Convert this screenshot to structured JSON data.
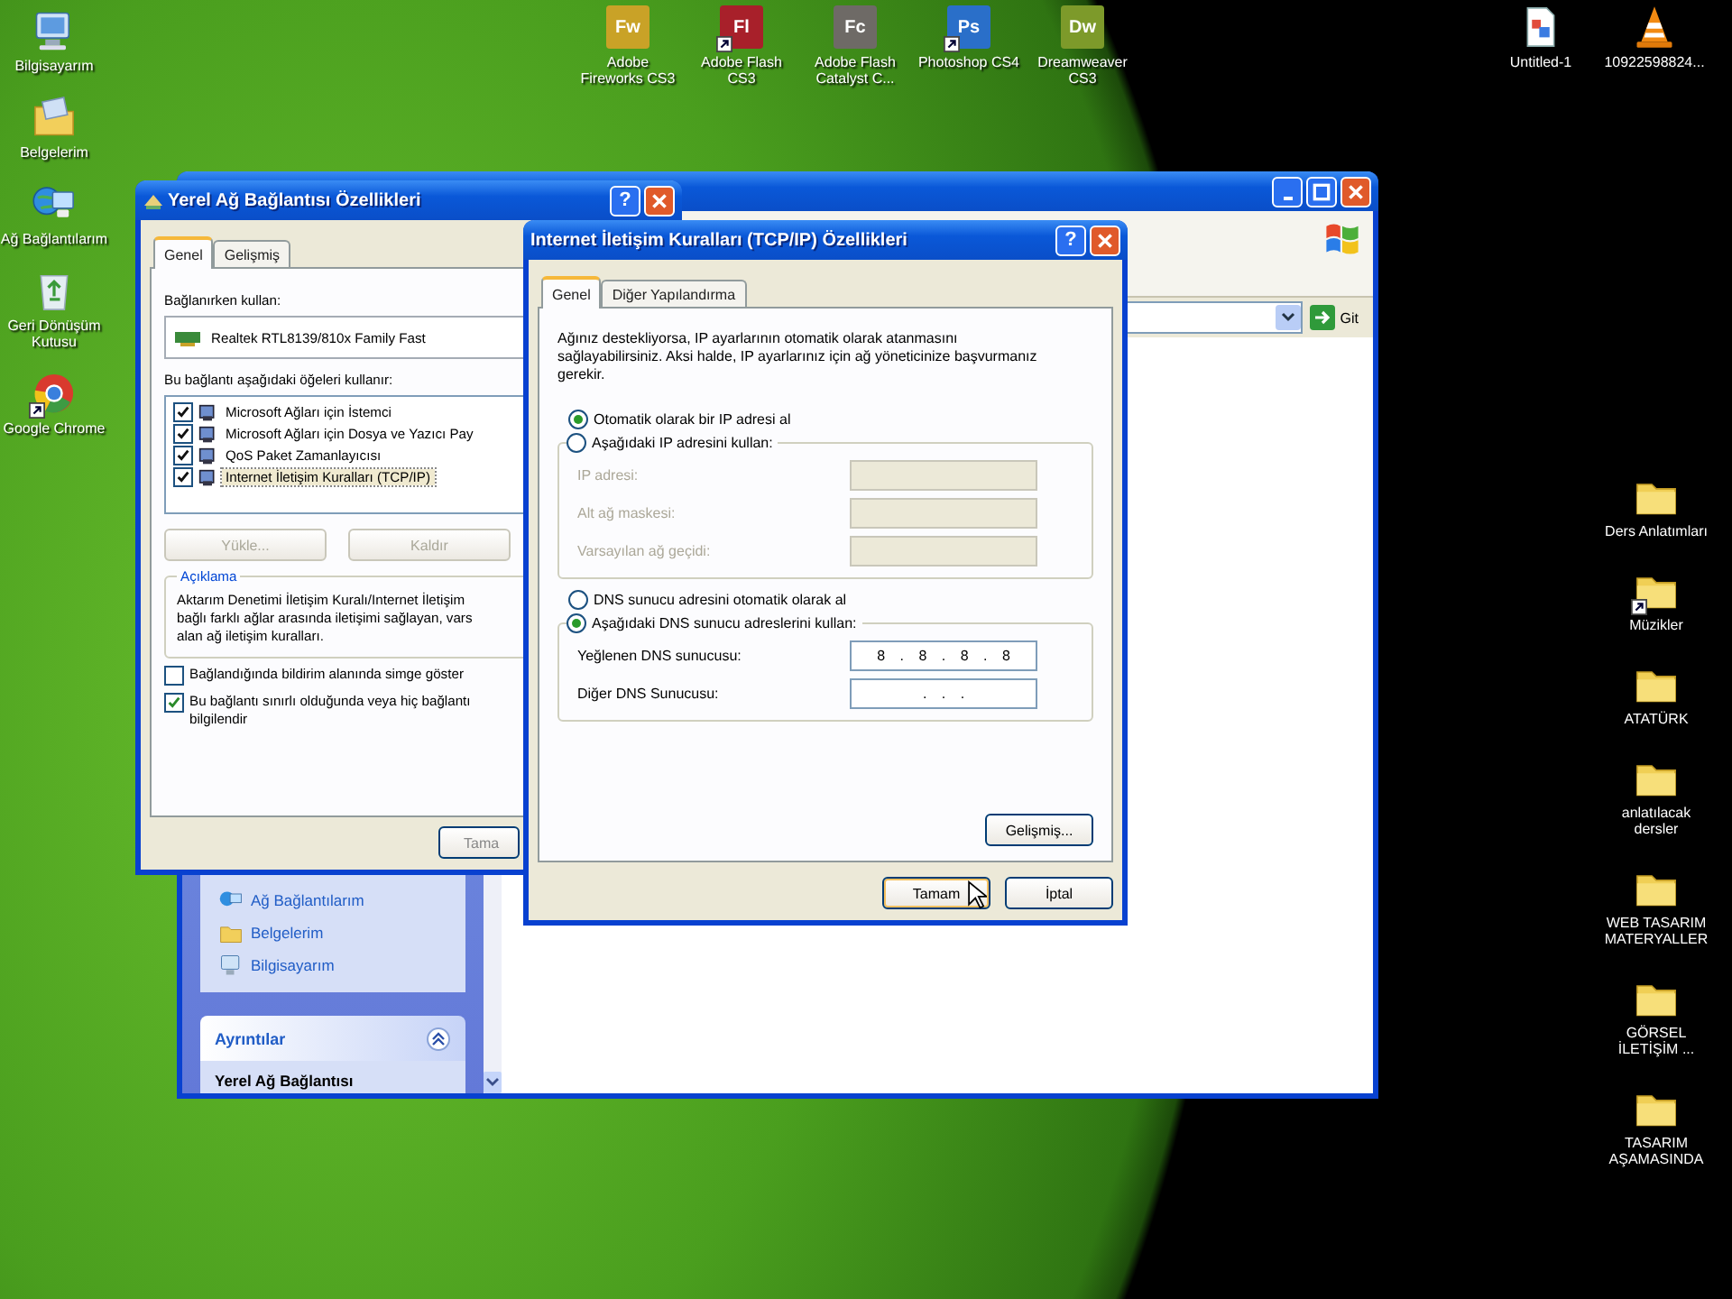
{
  "desktop": {
    "left_icons": [
      {
        "kind": "computer",
        "label": "Bilgisayarım",
        "shortcut": false
      },
      {
        "kind": "documents",
        "label": "Belgelerim",
        "shortcut": false
      },
      {
        "kind": "network",
        "label": "Ağ Bağlantılarım",
        "shortcut": false
      },
      {
        "kind": "recycle",
        "label": "Geri Dönüşüm Kutusu",
        "shortcut": false
      },
      {
        "kind": "browser",
        "label": "Google Chrome",
        "shortcut": true
      }
    ],
    "top_icons": [
      {
        "kind": "app",
        "badge": "Fw",
        "color": "#c9a227",
        "label": "Adobe Fireworks CS3",
        "shortcut": false
      },
      {
        "kind": "app",
        "badge": "Fl",
        "color": "#a8202a",
        "label": "Adobe Flash CS3",
        "shortcut": true
      },
      {
        "kind": "app",
        "badge": "Fc",
        "color": "#6e6a66",
        "label": "Adobe Flash Catalyst C...",
        "shortcut": false
      },
      {
        "kind": "app",
        "badge": "Ps",
        "color": "#2a6fc9",
        "label": "Photoshop CS4",
        "shortcut": true
      },
      {
        "kind": "app",
        "badge": "Dw",
        "color": "#7d9a2a",
        "label": "Dreamweaver CS3",
        "shortcut": false
      }
    ],
    "top_right_icons": [
      {
        "kind": "file",
        "label": "Untitled-1",
        "shortcut": false
      },
      {
        "kind": "cone",
        "label": "10922598824...",
        "shortcut": false
      }
    ],
    "right_icons": [
      {
        "kind": "folder",
        "label": "Ders Anlatımları",
        "shortcut": false
      },
      {
        "kind": "folder",
        "label": "Müzikler",
        "shortcut": true
      },
      {
        "kind": "folder",
        "label": "ATATÜRK",
        "shortcut": false
      },
      {
        "kind": "folder",
        "label": "anlatılacak dersler",
        "shortcut": false
      },
      {
        "kind": "folder",
        "label": "WEB TASARIM MATERYALLER",
        "shortcut": false
      },
      {
        "kind": "folder",
        "label": "GÖRSEL İLETİŞİM ...",
        "shortcut": false
      },
      {
        "kind": "folder",
        "label": "TASARIM AŞAMASINDA",
        "shortcut": false
      }
    ]
  },
  "explorer_window": {
    "go_button": "Git",
    "tasks": [
      {
        "kind": "network",
        "label": "Ağ Bağlantılarım"
      },
      {
        "kind": "documents",
        "label": "Belgelerim"
      },
      {
        "kind": "computer",
        "label": "Bilgisayarım"
      }
    ],
    "details": {
      "title": "Ayrıntılar",
      "expanded": true,
      "name": "Yerel Ağ Bağlantısı"
    }
  },
  "connection_dialog": {
    "title": "Yerel Ağ Bağlantısı Özellikleri",
    "help_button": "?",
    "tabs": [
      {
        "label": "Genel",
        "selected": true
      },
      {
        "label": "Gelişmiş",
        "selected": false
      }
    ],
    "connect_label": "Bağlanırken kullan:",
    "adapter": "Realtek RTL8139/810x Family Fast",
    "components_label": "Bu bağlantı aşağıdaki öğeleri kullanır:",
    "components": [
      {
        "label": "Microsoft Ağları için İstemci",
        "checked": true,
        "selected": false
      },
      {
        "label": "Microsoft Ağları için Dosya ve Yazıcı Pay",
        "checked": true,
        "selected": false
      },
      {
        "label": "QoS Paket Zamanlayıcısı",
        "checked": true,
        "selected": false
      },
      {
        "label": "Internet İletişim Kuralları (TCP/IP)",
        "checked": true,
        "selected": true
      }
    ],
    "buttons": [
      {
        "label": "Yükle...",
        "disabled": true
      },
      {
        "label": "Kaldır",
        "disabled": true
      }
    ],
    "description_title": "Açıklama",
    "description": "Aktarım Denetimi İletişim Kuralı/Internet İletişim\nbağlı farklı ağlar arasında iletişimi sağlayan, vars\nalan ağ iletişim kuralları.",
    "options": [
      {
        "label": "Bağlandığında bildirim alanında simge göster",
        "checked": false
      },
      {
        "label": "Bu bağlantı sınırlı olduğunda veya hiç bağlantı\nbilgilendir",
        "checked": true
      }
    ],
    "ok_button": "Tama"
  },
  "tcpip_dialog": {
    "title": "Internet İletişim Kuralları (TCP/IP) Özellikleri",
    "help_button": "?",
    "tabs": [
      {
        "label": "Genel",
        "selected": true
      },
      {
        "label": "Diğer Yapılandırma",
        "selected": false
      }
    ],
    "intro": "Ağınız destekliyorsa, IP ayarlarının otomatik olarak atanmasını sağlayabilirsiniz. Aksi halde, IP ayarlarınız için ağ yöneticinize başvurmanız gerekir.",
    "ip_modes": [
      {
        "label": "Otomatik olarak bir IP adresi al",
        "selected": true
      },
      {
        "label": "Aşağıdaki IP adresini kullan:",
        "selected": false
      }
    ],
    "ip_fields": [
      {
        "label": "IP adresi:",
        "disabled": true
      },
      {
        "label": "Alt ağ maskesi:",
        "disabled": true
      },
      {
        "label": "Varsayılan ağ geçidi:",
        "disabled": true
      }
    ],
    "dns_modes": [
      {
        "label": "DNS sunucu adresini otomatik olarak al",
        "selected": false
      },
      {
        "label": "Aşağıdaki DNS sunucu adreslerini kullan:",
        "selected": true
      }
    ],
    "dns_fields": [
      {
        "label": "Yeğlenen DNS sunucusu:",
        "value": "8 . 8 . 8 . 8",
        "disabled": false
      },
      {
        "label": "Diğer DNS Sunucusu:",
        "value": ". . .",
        "disabled": false
      }
    ],
    "advanced_button": "Gelişmiş...",
    "ok_button": "Tamam",
    "cancel_button": "İptal"
  }
}
